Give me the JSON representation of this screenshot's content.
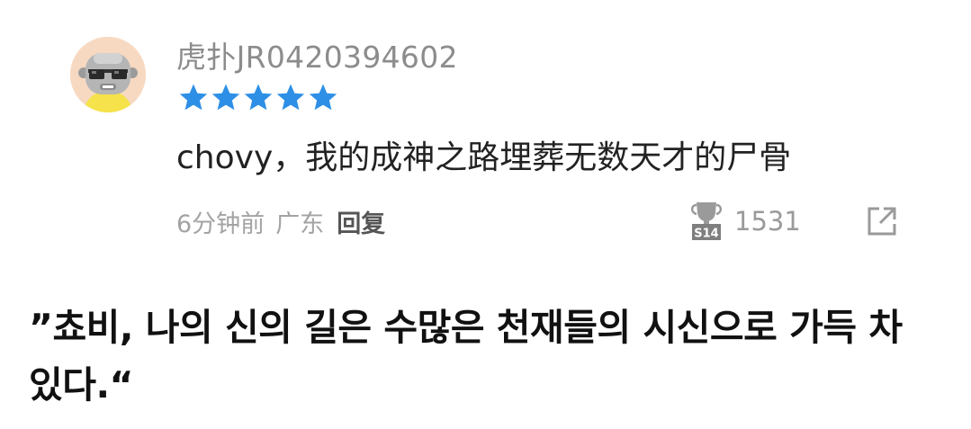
{
  "comment": {
    "username": "虎扑JR0420394602",
    "rating": 5,
    "text": "chovy，我的成神之路埋葬无数天才的尸骨",
    "time": "6分钟前",
    "location": "广东",
    "reply_label": "回复",
    "likes": "1531",
    "like_badge_text": "S14",
    "icons": {
      "avatar": "cartoon-avatar-with-sunglasses",
      "star": "star-icon",
      "like": "s14-trophy-icon",
      "share": "share-icon"
    },
    "colors": {
      "star": "#2e8fe6",
      "username": "#8c8c8c",
      "avatar_bg": "#f7d9c2"
    }
  },
  "translation": {
    "text": "”쵸비, 나의 신의 길은 수많은 천재들의 시신으로 가득 차 있다.“"
  }
}
